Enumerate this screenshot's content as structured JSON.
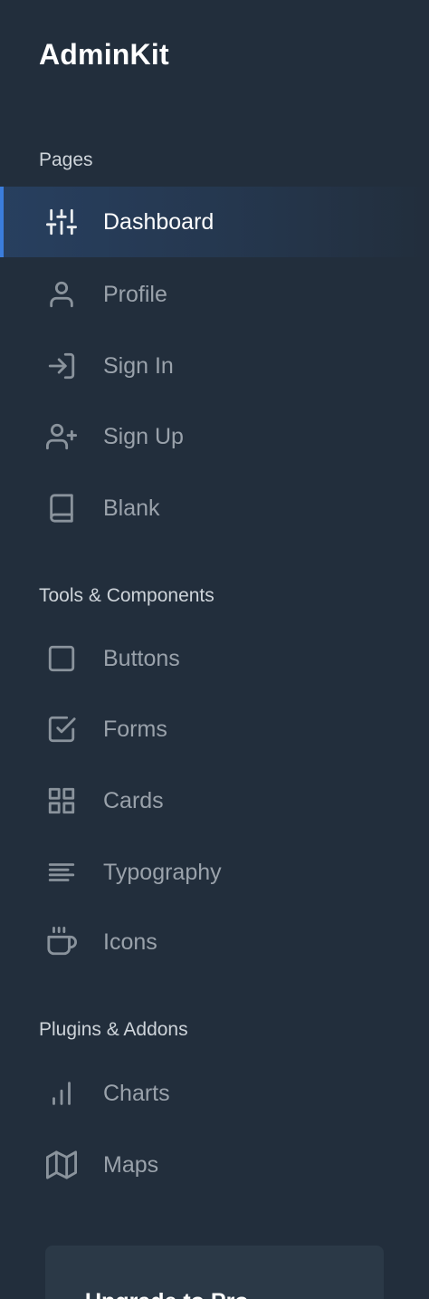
{
  "brand": "AdminKit",
  "sections": {
    "pages": "Pages",
    "tools": "Tools & Components",
    "plugins": "Plugins & Addons"
  },
  "nav": {
    "dashboard": "Dashboard",
    "profile": "Profile",
    "sign_in": "Sign In",
    "sign_up": "Sign Up",
    "blank": "Blank",
    "buttons": "Buttons",
    "forms": "Forms",
    "cards": "Cards",
    "typography": "Typography",
    "icons": "Icons",
    "charts": "Charts",
    "maps": "Maps"
  },
  "active_item": "dashboard",
  "upgrade": {
    "title": "Upgrade to Pro"
  },
  "colors": {
    "sidebar_bg": "#222e3c",
    "accent": "#3b7ddd",
    "text_active": "#ffffff",
    "text_muted": "#9aa2ab"
  }
}
